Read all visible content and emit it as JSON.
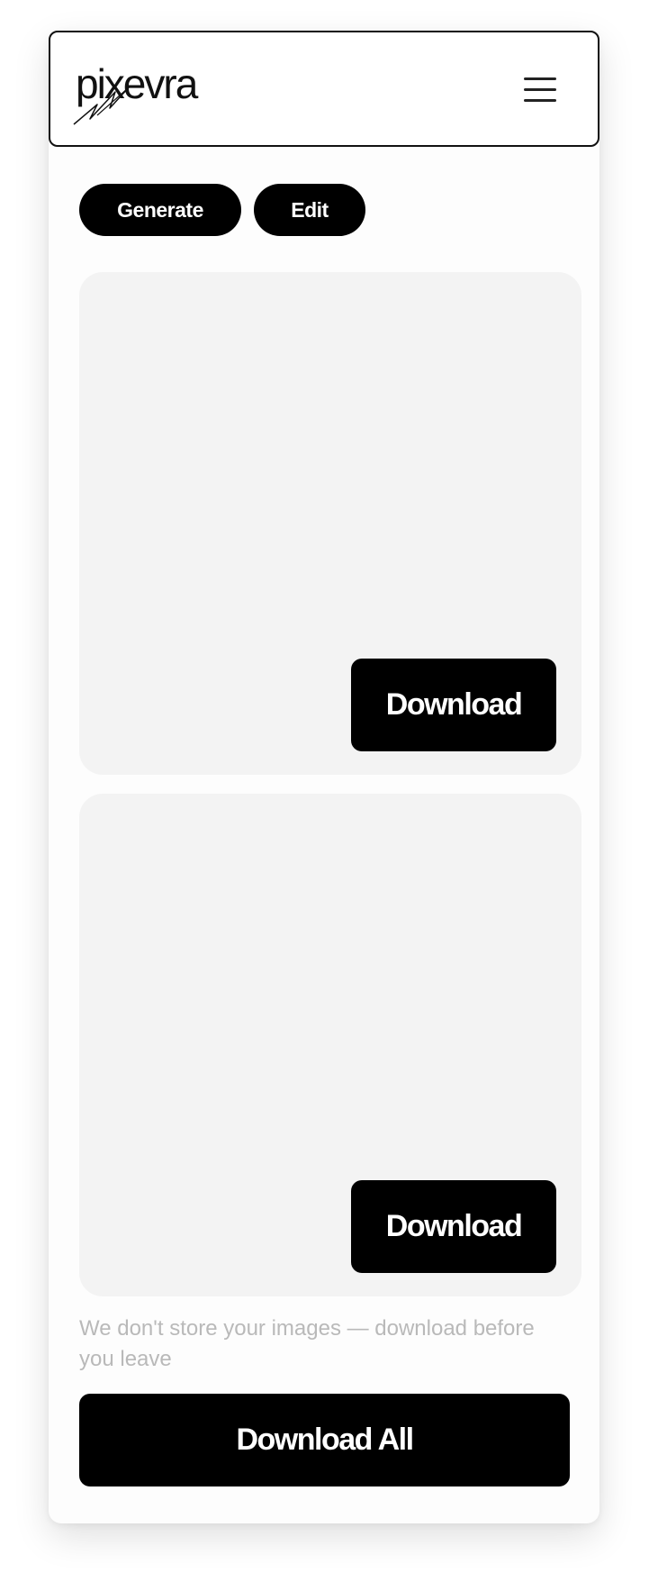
{
  "header": {
    "logo_text": "pixevra",
    "menu_icon": "hamburger-menu-icon"
  },
  "tabs": [
    {
      "label": "Generate"
    },
    {
      "label": "Edit"
    }
  ],
  "images": [
    {
      "download_label": "Download"
    },
    {
      "download_label": "Download"
    }
  ],
  "notice": "We don't store your images — download before you leave",
  "download_all_label": "Download All",
  "colors": {
    "button_bg": "#000000",
    "button_text": "#ffffff",
    "card_bg": "#f3f3f3",
    "notice_text": "#b9b9b9"
  }
}
